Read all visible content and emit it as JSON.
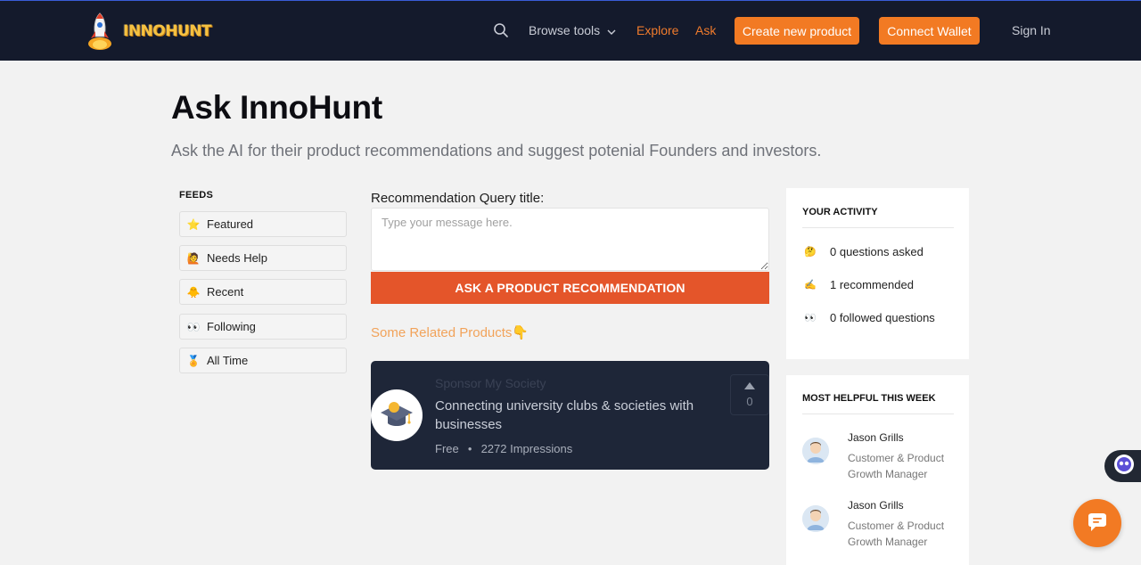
{
  "header": {
    "logo_text": "INNOHUNT",
    "browse_label": "Browse tools",
    "explore_label": "Explore",
    "ask_label": "Ask",
    "create_label": "Create new product",
    "wallet_label": "Connect Wallet",
    "signin_label": "Sign In"
  },
  "page": {
    "title": "Ask InnoHunt",
    "subtitle": "Ask the AI for their product recommendations and suggest potenial Founders and investors."
  },
  "feeds": {
    "label": "FEEDS",
    "items": [
      {
        "label": "Featured",
        "icon": "star-icon",
        "emoji": "⭐"
      },
      {
        "label": "Needs Help",
        "icon": "raised-hand-icon",
        "emoji": "🙋"
      },
      {
        "label": "Recent",
        "icon": "chick-icon",
        "emoji": "🐥"
      },
      {
        "label": "Following",
        "icon": "eyes-icon",
        "emoji": "👀"
      },
      {
        "label": "All Time",
        "icon": "medal-icon",
        "emoji": "🏅"
      }
    ]
  },
  "query": {
    "label": "Recommendation Query title:",
    "placeholder": "Type your message here.",
    "button_label": "ASK A PRODUCT RECOMMENDATION",
    "related_label": "Some Related Products👇"
  },
  "product": {
    "name": "Sponsor My Society",
    "description": "Connecting university clubs & societies with businesses",
    "price": "Free",
    "impressions": "2272 Impressions",
    "votes": "0",
    "icon": "graduation-cap-icon"
  },
  "activity": {
    "title": "YOUR ACTIVITY",
    "items": [
      {
        "label": "0 questions asked",
        "emoji": "🤔"
      },
      {
        "label": "1 recommended",
        "emoji": "✍️"
      },
      {
        "label": "0 followed questions",
        "emoji": "👀"
      }
    ]
  },
  "helpful": {
    "title": "MOST HELPFUL THIS WEEK",
    "people": [
      {
        "name": "Jason Grills",
        "role": "Customer & Product Growth Manager"
      },
      {
        "name": "Jason Grills",
        "role": "Customer & Product Growth Manager"
      }
    ]
  },
  "colors": {
    "accent": "#f27a23",
    "header_bg": "#141a2c",
    "ask_button": "#e4552a",
    "card_bg": "#1e2638"
  }
}
